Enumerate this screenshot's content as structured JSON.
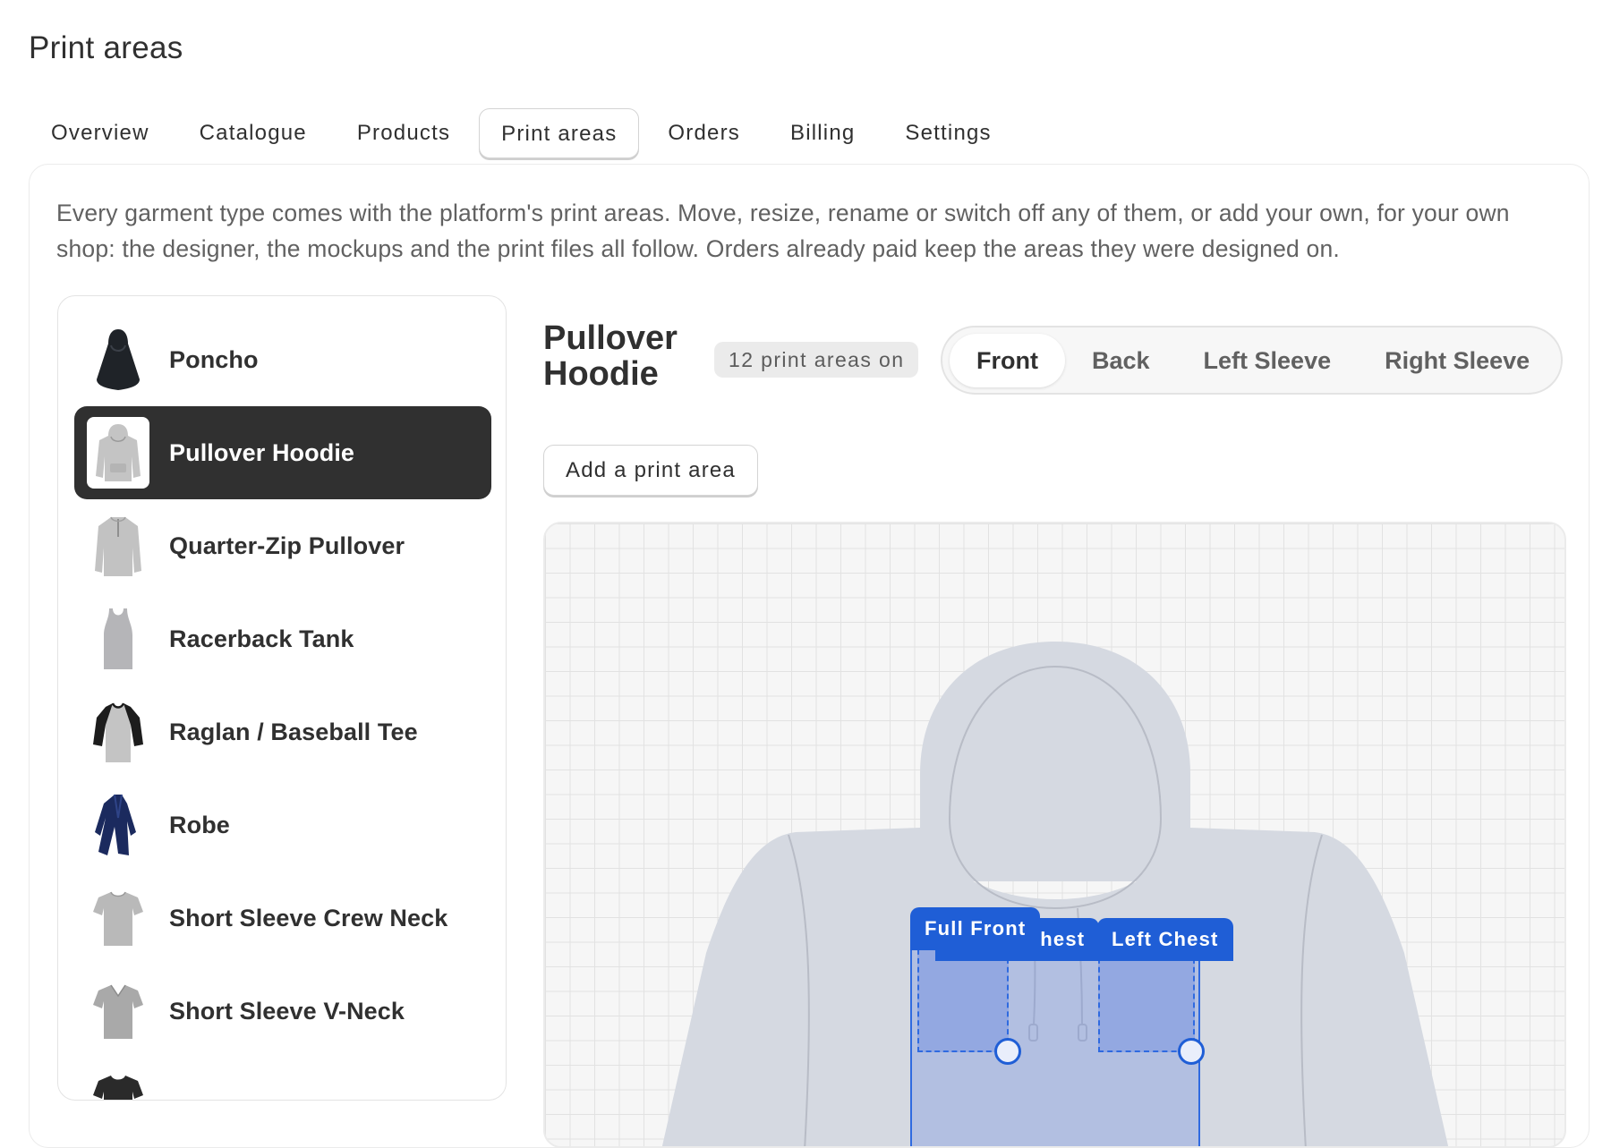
{
  "page": {
    "title": "Print areas"
  },
  "tabs": [
    {
      "label": "Overview"
    },
    {
      "label": "Catalogue"
    },
    {
      "label": "Products"
    },
    {
      "label": "Print areas"
    },
    {
      "label": "Orders"
    },
    {
      "label": "Billing"
    },
    {
      "label": "Settings"
    }
  ],
  "active_tab": "Print areas",
  "intro": "Every garment type comes with the platform's print areas. Move, resize, rename or switch off any of them, or add your own, for your own shop: the designer, the mockups and the print files all follow. Orders already paid keep the areas they were designed on.",
  "garments": [
    {
      "name": "Poncho",
      "icon": "poncho-icon",
      "color": "#1f2328"
    },
    {
      "name": "Pullover Hoodie",
      "icon": "hoodie-icon",
      "color": "#c4c4c4",
      "selected": true
    },
    {
      "name": "Quarter-Zip Pullover",
      "icon": "quarter-zip-icon",
      "color": "#c2c2c2"
    },
    {
      "name": "Racerback Tank",
      "icon": "tank-icon",
      "color": "#b5b5b8"
    },
    {
      "name": "Raglan / Baseball Tee",
      "icon": "raglan-icon",
      "color": "#1c1c1c"
    },
    {
      "name": "Robe",
      "icon": "robe-icon",
      "color": "#1b2a5e"
    },
    {
      "name": "Short Sleeve Crew Neck",
      "icon": "crew-neck-icon",
      "color": "#b9b9b9"
    },
    {
      "name": "Short Sleeve V-Neck",
      "icon": "v-neck-icon",
      "color": "#a9a9a9"
    }
  ],
  "product": {
    "title": "Pullover Hoodie",
    "areas_badge": "12 print areas on"
  },
  "sides": [
    {
      "label": "Front",
      "active": true
    },
    {
      "label": "Back"
    },
    {
      "label": "Left Sleeve"
    },
    {
      "label": "Right Sleeve"
    }
  ],
  "add_button": "Add a print area",
  "print_areas": [
    {
      "label": "Full Front"
    },
    {
      "label": "Center Chest"
    },
    {
      "label": "Left Chest"
    }
  ],
  "colors": {
    "text": "#303030",
    "muted": "#616161",
    "selected_bg": "#303030",
    "accent": "#1f5ed6",
    "garment_fill": "#d5d9e1",
    "garment_stroke": "#b8bcc6"
  }
}
